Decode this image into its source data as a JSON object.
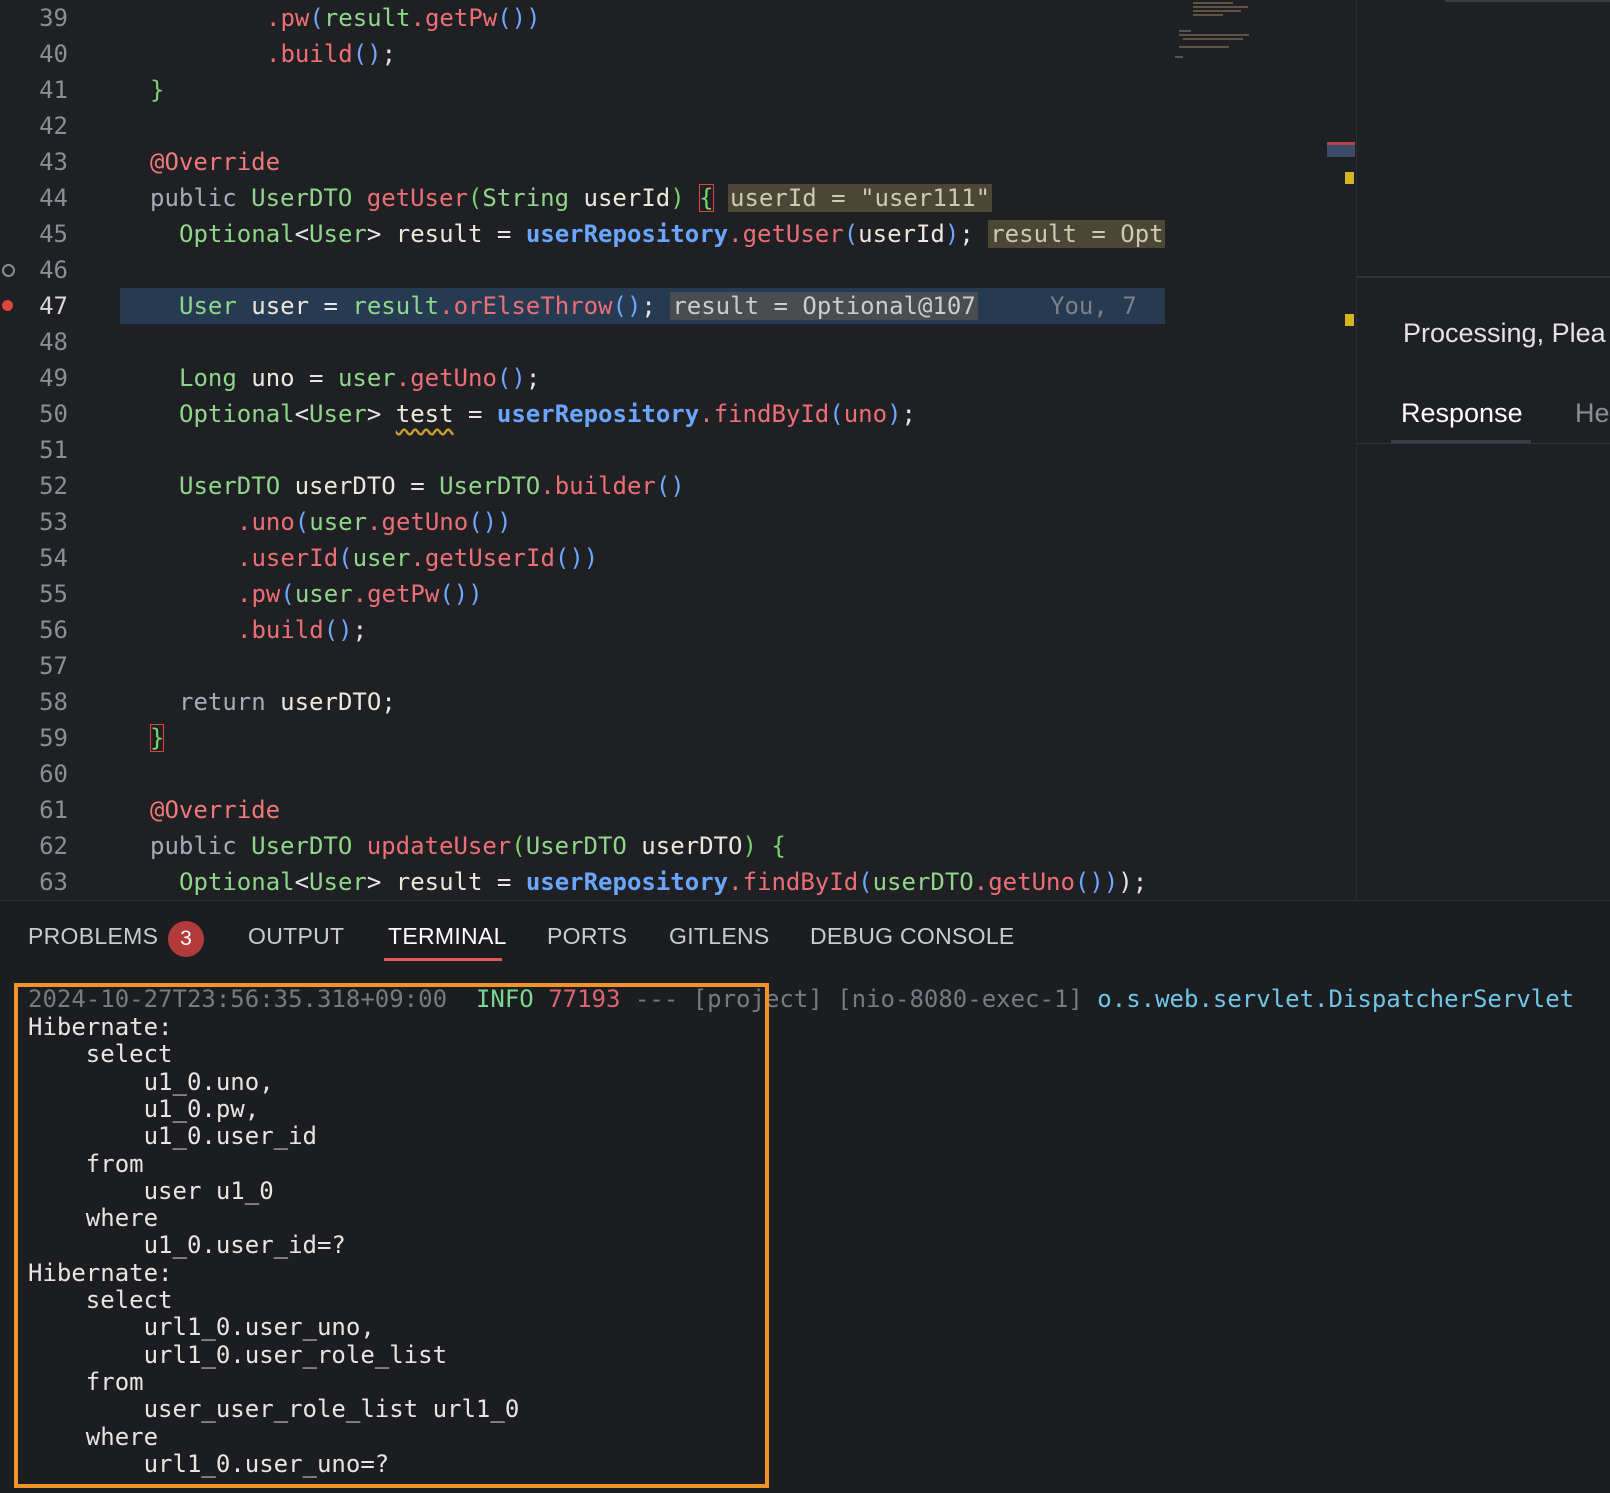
{
  "editor": {
    "lines": [
      {
        "n": "39",
        "indent": 4,
        "tokens": [
          {
            "t": ".pw",
            "c": "fn"
          },
          {
            "t": "(",
            "c": "pu"
          },
          {
            "t": "result",
            "c": "ty"
          },
          {
            "t": ".",
            "c": "fn"
          },
          {
            "t": "getPw",
            "c": "fn"
          },
          {
            "t": "())",
            "c": "pu"
          }
        ]
      },
      {
        "n": "40",
        "indent": 4,
        "tokens": [
          {
            "t": ".build",
            "c": "fn"
          },
          {
            "t": "()",
            "c": "pu"
          },
          {
            "t": ";",
            "c": "pn"
          }
        ]
      },
      {
        "n": "41",
        "indent": 0,
        "tokens": [
          {
            "t": "}",
            "c": "br-g"
          }
        ]
      },
      {
        "n": "42",
        "indent": 0,
        "tokens": []
      },
      {
        "n": "43",
        "indent": 0,
        "tokens": [
          {
            "t": "@Override",
            "c": "an"
          }
        ]
      },
      {
        "n": "44",
        "indent": 0,
        "tokens": [
          {
            "t": "public ",
            "c": "kw"
          },
          {
            "t": "UserDTO ",
            "c": "ty"
          },
          {
            "t": "getUser",
            "c": "fn"
          },
          {
            "t": "(",
            "c": "br-g"
          },
          {
            "t": "String ",
            "c": "ty"
          },
          {
            "t": "userId",
            "c": "pl"
          },
          {
            "t": ") ",
            "c": "br-g"
          },
          {
            "t": "{",
            "c": "br-g boxed"
          },
          {
            "t": " ",
            "c": "pn"
          },
          {
            "t": "userId = \"user111\"",
            "c": "inlay"
          }
        ]
      },
      {
        "n": "45",
        "indent": 1,
        "tokens": [
          {
            "t": "Optional",
            "c": "ty"
          },
          {
            "t": "<",
            "c": "pn"
          },
          {
            "t": "User",
            "c": "ty"
          },
          {
            "t": "> ",
            "c": "pn"
          },
          {
            "t": "result ",
            "c": "pl"
          },
          {
            "t": "= ",
            "c": "pn"
          },
          {
            "t": "userRepository",
            "c": "bl"
          },
          {
            "t": ".",
            "c": "fn"
          },
          {
            "t": "getUser",
            "c": "fn"
          },
          {
            "t": "(",
            "c": "pu"
          },
          {
            "t": "userId",
            "c": "pl"
          },
          {
            "t": ")",
            "c": "pu"
          },
          {
            "t": "; ",
            "c": "pn"
          },
          {
            "t": "result = Opt",
            "c": "inlay"
          }
        ]
      },
      {
        "n": "46",
        "indent": 0,
        "tokens": [],
        "marker": "hollow"
      },
      {
        "n": "47",
        "indent": 1,
        "current": true,
        "marker": "breakpoint",
        "tokens": [
          {
            "t": "User ",
            "c": "ty"
          },
          {
            "t": "user ",
            "c": "pl"
          },
          {
            "t": "= ",
            "c": "pn"
          },
          {
            "t": "result",
            "c": "ty"
          },
          {
            "t": ".",
            "c": "fn"
          },
          {
            "t": "orElseThrow",
            "c": "fn"
          },
          {
            "t": "()",
            "c": "pu"
          },
          {
            "t": "; ",
            "c": "pn"
          },
          {
            "t": "result = Optional@107",
            "c": "inlay2"
          },
          {
            "t": "     You, 7 ",
            "c": "blame"
          }
        ]
      },
      {
        "n": "48",
        "indent": 0,
        "tokens": []
      },
      {
        "n": "49",
        "indent": 1,
        "tokens": [
          {
            "t": "Long ",
            "c": "ty"
          },
          {
            "t": "uno ",
            "c": "pl"
          },
          {
            "t": "= ",
            "c": "pn"
          },
          {
            "t": "user",
            "c": "ty"
          },
          {
            "t": ".",
            "c": "fn"
          },
          {
            "t": "getUno",
            "c": "fn"
          },
          {
            "t": "()",
            "c": "pu"
          },
          {
            "t": ";",
            "c": "pn"
          }
        ]
      },
      {
        "n": "50",
        "indent": 1,
        "tokens": [
          {
            "t": "Optional",
            "c": "ty"
          },
          {
            "t": "<",
            "c": "pn"
          },
          {
            "t": "User",
            "c": "ty"
          },
          {
            "t": "> ",
            "c": "pn"
          },
          {
            "t": "test",
            "c": "pl squiggle"
          },
          {
            "t": " = ",
            "c": "pn"
          },
          {
            "t": "userRepository",
            "c": "bl"
          },
          {
            "t": ".",
            "c": "fn"
          },
          {
            "t": "findById",
            "c": "fn"
          },
          {
            "t": "(",
            "c": "pu"
          },
          {
            "t": "uno",
            "c": "fn"
          },
          {
            "t": ")",
            "c": "pu"
          },
          {
            "t": ";",
            "c": "pn"
          }
        ]
      },
      {
        "n": "51",
        "indent": 0,
        "tokens": []
      },
      {
        "n": "52",
        "indent": 1,
        "tokens": [
          {
            "t": "UserDTO ",
            "c": "ty"
          },
          {
            "t": "userDTO ",
            "c": "pl"
          },
          {
            "t": "= ",
            "c": "pn"
          },
          {
            "t": "UserDTO",
            "c": "ty"
          },
          {
            "t": ".",
            "c": "fn"
          },
          {
            "t": "builder",
            "c": "fn"
          },
          {
            "t": "()",
            "c": "pu"
          }
        ]
      },
      {
        "n": "53",
        "indent": 3,
        "tokens": [
          {
            "t": ".uno",
            "c": "fn"
          },
          {
            "t": "(",
            "c": "pu"
          },
          {
            "t": "user",
            "c": "ty"
          },
          {
            "t": ".",
            "c": "fn"
          },
          {
            "t": "getUno",
            "c": "fn"
          },
          {
            "t": "())",
            "c": "pu"
          }
        ]
      },
      {
        "n": "54",
        "indent": 3,
        "tokens": [
          {
            "t": ".userId",
            "c": "fn"
          },
          {
            "t": "(",
            "c": "pu"
          },
          {
            "t": "user",
            "c": "ty"
          },
          {
            "t": ".",
            "c": "fn"
          },
          {
            "t": "getUserId",
            "c": "fn"
          },
          {
            "t": "())",
            "c": "pu"
          }
        ]
      },
      {
        "n": "55",
        "indent": 3,
        "tokens": [
          {
            "t": ".pw",
            "c": "fn"
          },
          {
            "t": "(",
            "c": "pu"
          },
          {
            "t": "user",
            "c": "ty"
          },
          {
            "t": ".",
            "c": "fn"
          },
          {
            "t": "getPw",
            "c": "fn"
          },
          {
            "t": "())",
            "c": "pu"
          }
        ]
      },
      {
        "n": "56",
        "indent": 3,
        "tokens": [
          {
            "t": ".build",
            "c": "fn"
          },
          {
            "t": "()",
            "c": "pu"
          },
          {
            "t": ";",
            "c": "pn"
          }
        ]
      },
      {
        "n": "57",
        "indent": 0,
        "tokens": []
      },
      {
        "n": "58",
        "indent": 1,
        "tokens": [
          {
            "t": "return ",
            "c": "kw"
          },
          {
            "t": "userDTO",
            "c": "pl"
          },
          {
            "t": ";",
            "c": "pn"
          }
        ]
      },
      {
        "n": "59",
        "indent": 0,
        "tokens": [
          {
            "t": "}",
            "c": "br-g boxed"
          }
        ]
      },
      {
        "n": "60",
        "indent": 0,
        "tokens": []
      },
      {
        "n": "61",
        "indent": 0,
        "tokens": [
          {
            "t": "@Override",
            "c": "an"
          }
        ]
      },
      {
        "n": "62",
        "indent": 0,
        "tokens": [
          {
            "t": "public ",
            "c": "kw"
          },
          {
            "t": "UserDTO ",
            "c": "ty"
          },
          {
            "t": "updateUser",
            "c": "fn"
          },
          {
            "t": "(",
            "c": "br-g"
          },
          {
            "t": "UserDTO ",
            "c": "ty"
          },
          {
            "t": "userDTO",
            "c": "pl"
          },
          {
            "t": ") ",
            "c": "br-g"
          },
          {
            "t": "{",
            "c": "br-g"
          }
        ]
      },
      {
        "n": "63",
        "indent": 1,
        "tokens": [
          {
            "t": "Optional",
            "c": "ty"
          },
          {
            "t": "<",
            "c": "pn"
          },
          {
            "t": "User",
            "c": "ty"
          },
          {
            "t": "> ",
            "c": "pn"
          },
          {
            "t": "result ",
            "c": "pl"
          },
          {
            "t": "= ",
            "c": "pn"
          },
          {
            "t": "userRepository",
            "c": "bl"
          },
          {
            "t": ".",
            "c": "fn"
          },
          {
            "t": "findById",
            "c": "fn"
          },
          {
            "t": "(",
            "c": "pu"
          },
          {
            "t": "userDTO",
            "c": "ty"
          },
          {
            "t": ".",
            "c": "fn"
          },
          {
            "t": "getUno",
            "c": "fn"
          },
          {
            "t": "())",
            "c": "pu"
          },
          {
            "t": ");",
            "c": "pn"
          }
        ]
      }
    ]
  },
  "right_panel": {
    "status": "Processing, Plea",
    "tab_response": "Response",
    "tab_headers": "He"
  },
  "panel": {
    "tabs": {
      "problems": "PROBLEMS",
      "problems_count": "3",
      "output": "OUTPUT",
      "terminal": "TERMINAL",
      "ports": "PORTS",
      "gitlens": "GITLENS",
      "debug_console": "DEBUG CONSOLE"
    },
    "terminal": {
      "log_line": {
        "timestamp": "2024-10-27T23:56:35.318+09:00",
        "level": "INFO",
        "pid": "77193",
        "sep": "---",
        "app": "[project]",
        "thread": "[nio-8080-exec-1]",
        "logger": "o.s.web.servlet.DispatcherServlet"
      },
      "lines": [
        "Hibernate:",
        "    select",
        "        u1_0.uno,",
        "        u1_0.pw,",
        "        u1_0.user_id",
        "    from",
        "        user u1_0",
        "    where",
        "        u1_0.user_id=?",
        "Hibernate:",
        "    select",
        "        url1_0.user_uno,",
        "        url1_0.user_role_list",
        "    from",
        "        user_user_role_list url1_0",
        "    where",
        "        url1_0.user_uno=?"
      ]
    }
  },
  "colors": {
    "accent_active_tab": "#e05a57",
    "highlight_box": "#f0932b",
    "breakpoint": "#e0453c"
  }
}
